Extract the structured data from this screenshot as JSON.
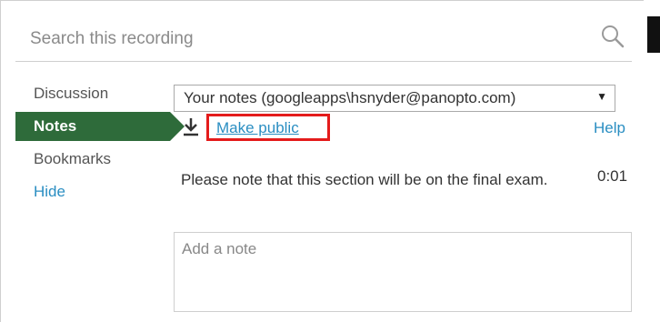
{
  "search": {
    "placeholder": "Search this recording",
    "icon": "search-icon"
  },
  "sidebar": {
    "items": [
      {
        "label": "Discussion"
      },
      {
        "label": "Notes"
      },
      {
        "label": "Bookmarks"
      },
      {
        "label": "Hide"
      }
    ],
    "active_index": 1,
    "accent_color": "#2e6b3a",
    "link_color": "#2a8ec2"
  },
  "notes": {
    "selected_source": "Your notes (googleapps\\hsnyder@panopto.com)",
    "download_icon": "download-icon",
    "make_public_label": "Make public",
    "highlight_color": "#e41b1b",
    "help_label": "Help",
    "entries": [
      {
        "text": "Please note that this section will be on the final exam.",
        "time": "0:01"
      }
    ],
    "add_note_placeholder": "Add a note"
  }
}
